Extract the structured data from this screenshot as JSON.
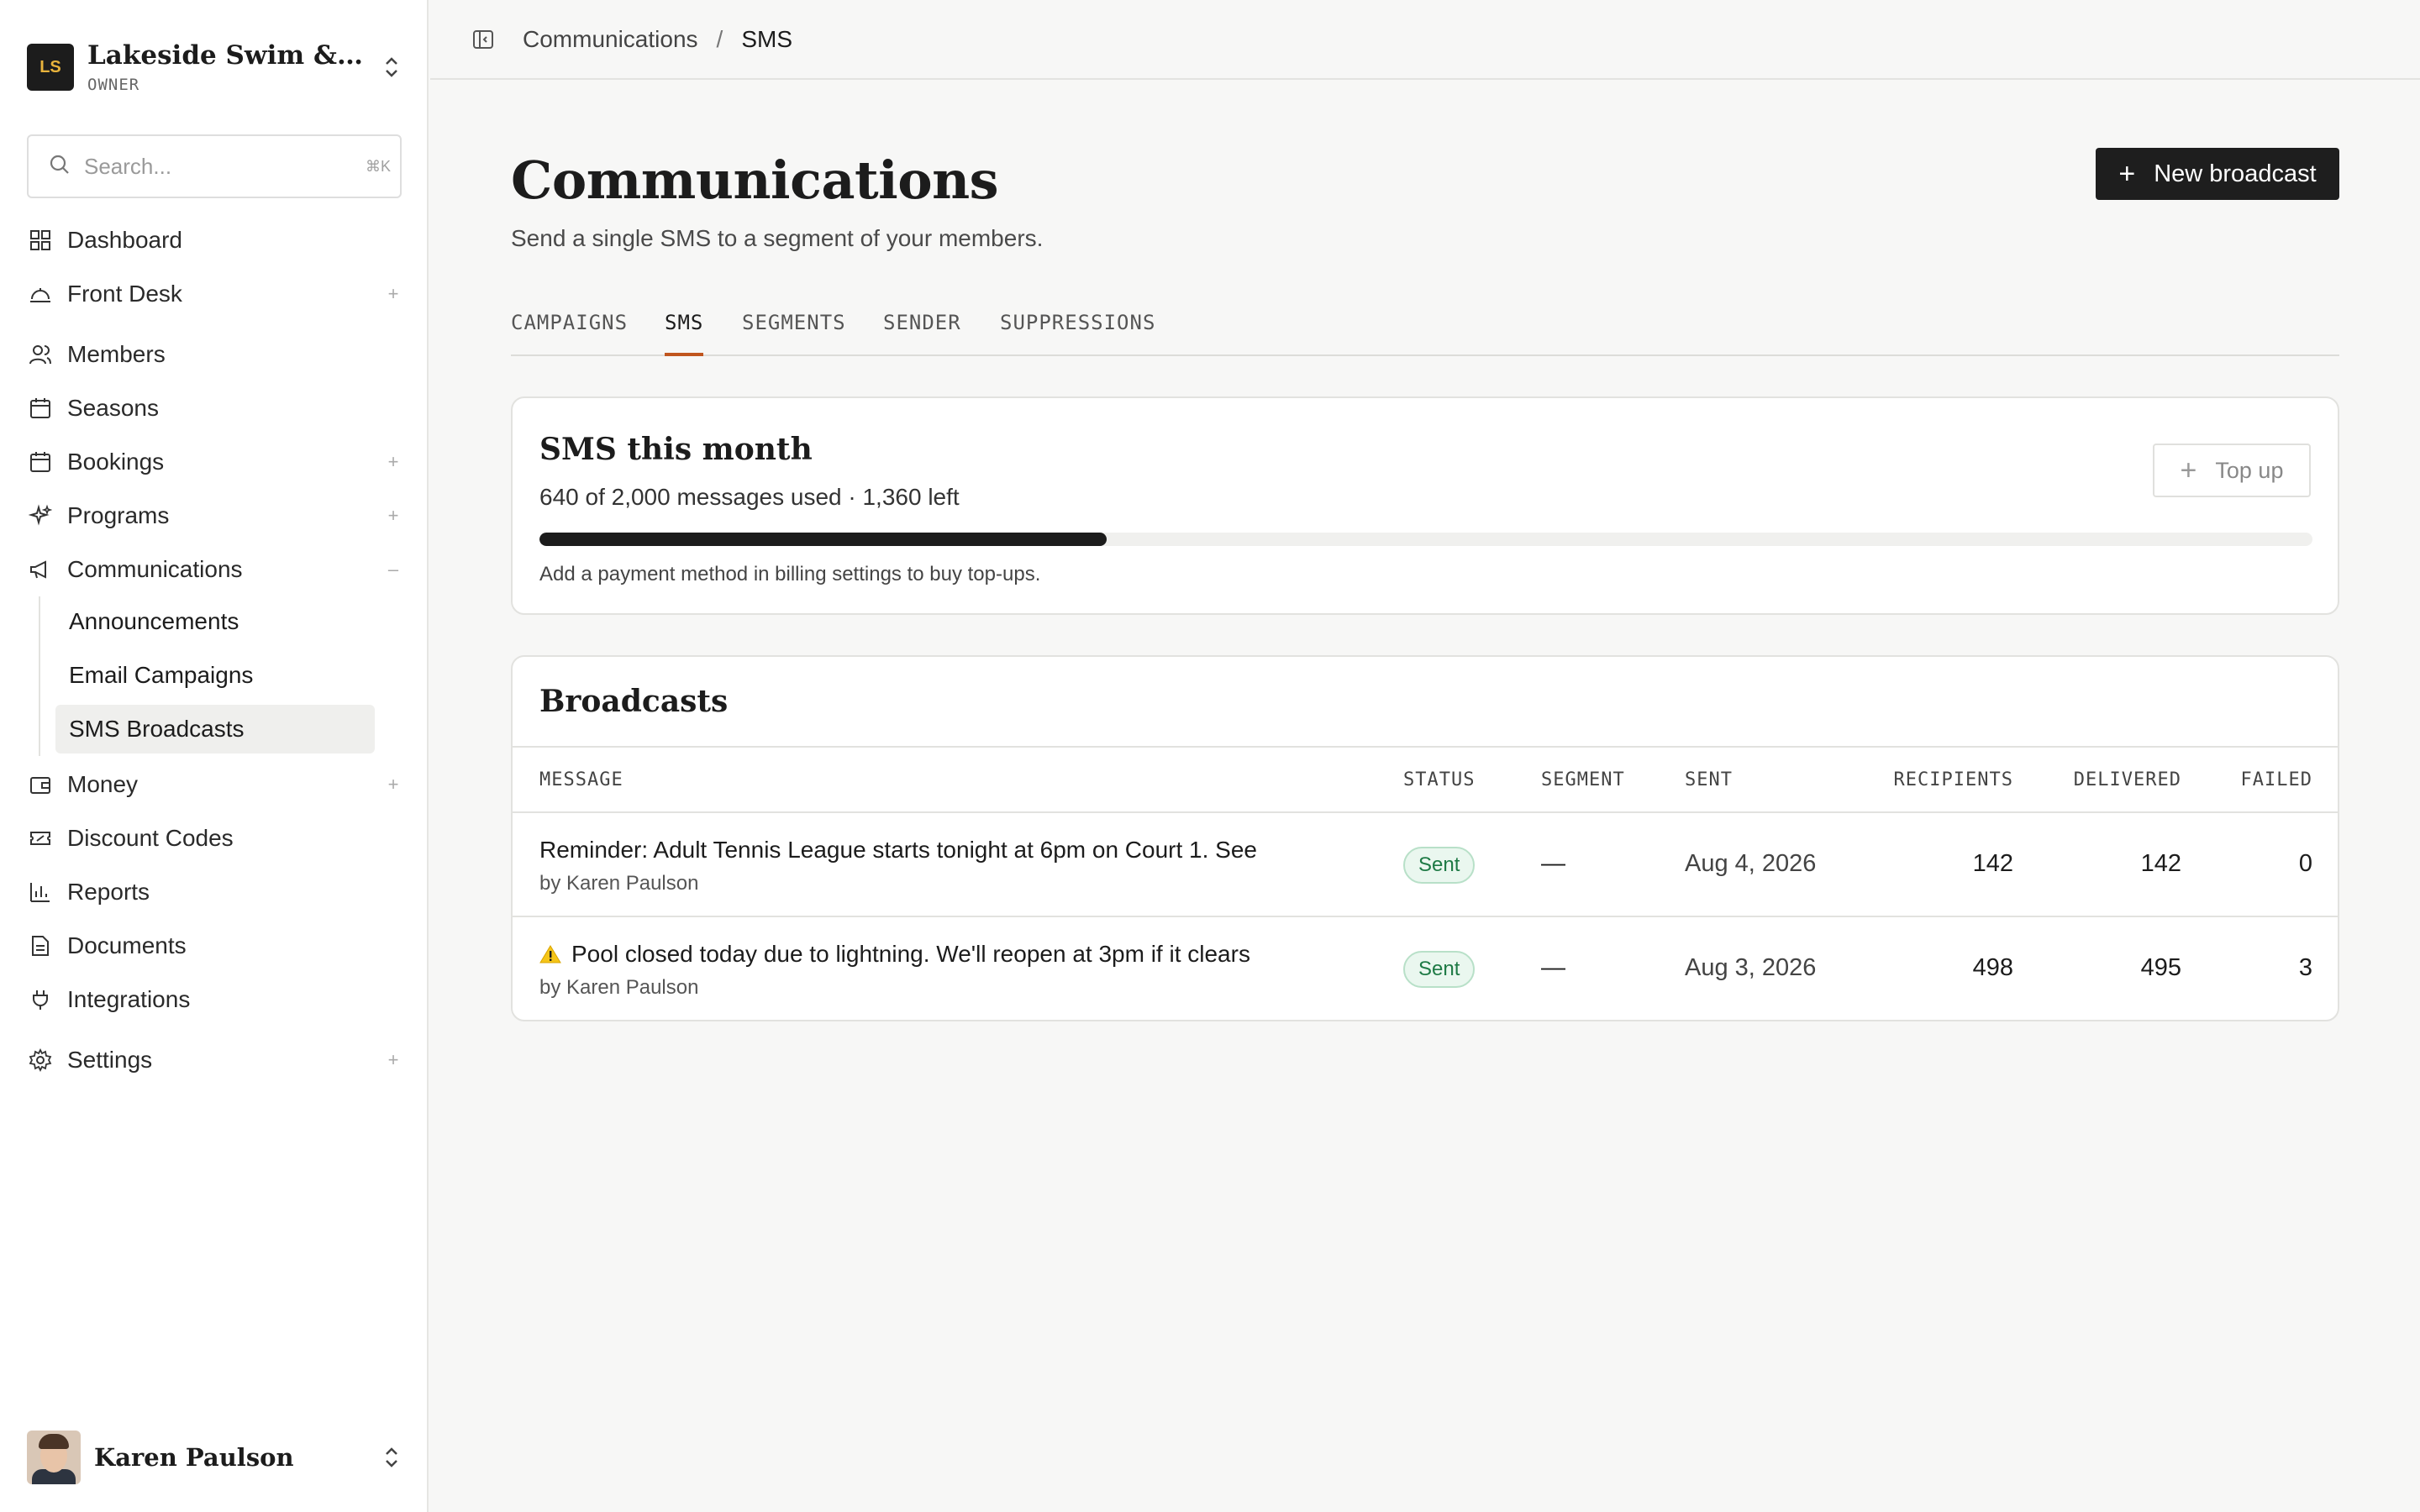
{
  "org": {
    "initials": "LS",
    "name": "Lakeside Swim & Ten...",
    "role": "OWNER"
  },
  "search": {
    "placeholder": "Search...",
    "shortcut": "⌘K"
  },
  "sidebar": {
    "items": [
      {
        "label": "Dashboard",
        "icon": "dashboard-icon",
        "expand": ""
      },
      {
        "label": "Front Desk",
        "icon": "front-desk-icon",
        "expand": "+"
      },
      {
        "label": "Members",
        "icon": "members-icon",
        "expand": ""
      },
      {
        "label": "Seasons",
        "icon": "calendar-icon",
        "expand": ""
      },
      {
        "label": "Bookings",
        "icon": "calendar-icon",
        "expand": "+"
      },
      {
        "label": "Programs",
        "icon": "sparkles-icon",
        "expand": "+"
      },
      {
        "label": "Communications",
        "icon": "megaphone-icon",
        "expand": "–"
      },
      {
        "label": "Money",
        "icon": "wallet-icon",
        "expand": "+"
      },
      {
        "label": "Discount Codes",
        "icon": "ticket-icon",
        "expand": ""
      },
      {
        "label": "Reports",
        "icon": "chart-icon",
        "expand": ""
      },
      {
        "label": "Documents",
        "icon": "document-icon",
        "expand": ""
      },
      {
        "label": "Integrations",
        "icon": "plug-icon",
        "expand": ""
      },
      {
        "label": "Settings",
        "icon": "gear-icon",
        "expand": "+"
      }
    ],
    "sub_items": [
      {
        "label": "Announcements",
        "active": false
      },
      {
        "label": "Email Campaigns",
        "active": false
      },
      {
        "label": "SMS Broadcasts",
        "active": true
      }
    ]
  },
  "user": {
    "name": "Karen Paulson"
  },
  "breadcrumb": {
    "parent": "Communications",
    "separator": "/",
    "current": "SMS"
  },
  "page": {
    "title": "Communications",
    "subtitle": "Send a single SMS to a segment of your members.",
    "new_button": "New broadcast"
  },
  "tabs": [
    {
      "label": "CAMPAIGNS",
      "active": false
    },
    {
      "label": "SMS",
      "active": true
    },
    {
      "label": "SEGMENTS",
      "active": false
    },
    {
      "label": "SENDER",
      "active": false
    },
    {
      "label": "SUPPRESSIONS",
      "active": false
    }
  ],
  "sms_usage": {
    "title": "SMS this month",
    "summary": "640 of 2,000 messages used · 1,360 left",
    "used": 640,
    "total": 2000,
    "note": "Add a payment method in billing settings to buy top-ups.",
    "topup_label": "Top up"
  },
  "broadcasts": {
    "title": "Broadcasts",
    "columns": [
      "MESSAGE",
      "STATUS",
      "SEGMENT",
      "SENT",
      "RECIPIENTS",
      "DELIVERED",
      "FAILED"
    ],
    "rows": [
      {
        "message": "Reminder: Adult Tennis League starts tonight at 6pm on Court 1. See",
        "author": "by Karen Paulson",
        "warning": false,
        "status": "Sent",
        "segment": "—",
        "sent": "Aug 4, 2026",
        "recipients": "142",
        "delivered": "142",
        "failed": "0"
      },
      {
        "message": "Pool closed today due to lightning. We'll reopen at 3pm if it clears",
        "author": "by Karen Paulson",
        "warning": true,
        "status": "Sent",
        "segment": "—",
        "sent": "Aug 3, 2026",
        "recipients": "498",
        "delivered": "495",
        "failed": "3"
      }
    ]
  },
  "colors": {
    "accent_tab": "#c0551e",
    "status_sent_bg": "#eaf7ef",
    "status_sent_text": "#1e7a45",
    "logo_text": "#e8b33c"
  }
}
